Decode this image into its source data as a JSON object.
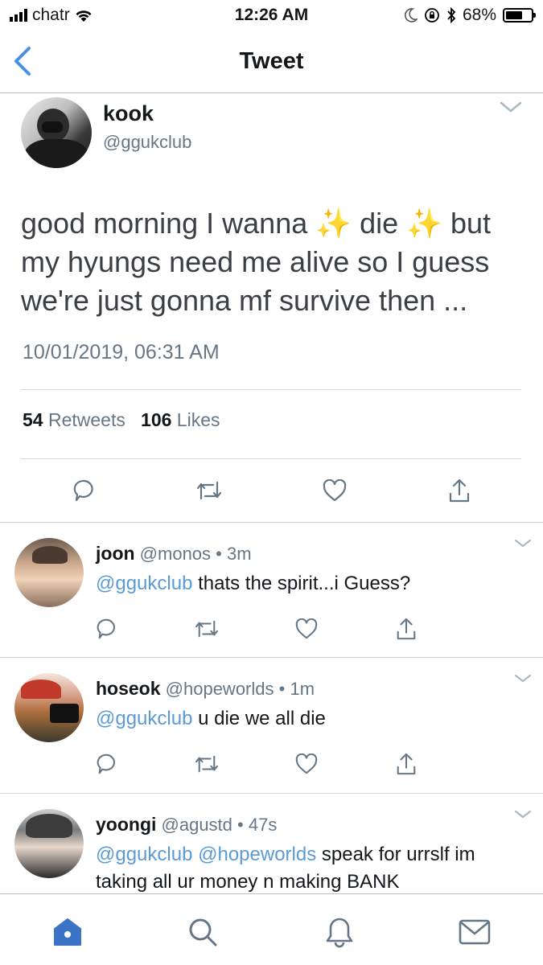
{
  "status_bar": {
    "carrier": "chatr",
    "time": "12:26 AM",
    "battery": "68%",
    "battery_level": 0.68
  },
  "nav": {
    "title": "Tweet"
  },
  "main_tweet": {
    "name": "kook",
    "handle": "@ggukclub",
    "text_part1": "good morning I wanna ",
    "sparkle": "✨",
    "text_part2": " die ",
    "text_part3": " but my hyungs need me alive so I guess we're just gonna mf survive then ...",
    "timestamp": "10/01/2019, 06:31 AM",
    "retweets_count": "54",
    "retweets_label": "Retweets",
    "likes_count": "106",
    "likes_label": "Likes"
  },
  "replies": [
    {
      "name": "joon",
      "handle": "@monos",
      "time": "3m",
      "mentions": "@ggukclub",
      "text": " thats the spirit...i Guess?"
    },
    {
      "name": "hoseok",
      "handle": "@hopeworlds",
      "time": "1m",
      "mentions": "@ggukclub",
      "text": " u die we all die"
    },
    {
      "name": "yoongi",
      "handle": "@agustd",
      "time": "47s",
      "mentions": "@ggukclub @hopeworlds",
      "text": " speak for urrslf im taking all ur money n making BANK"
    }
  ],
  "separator": "•",
  "colors": {
    "accent": "#4a90e2",
    "tab_active": "#3b73c7",
    "mention": "#5b9bd5",
    "muted": "#657786"
  },
  "icons": {
    "tabs": [
      "home-icon",
      "search-icon",
      "notifications-bell-icon",
      "messages-envelope-icon"
    ],
    "actions": [
      "reply-icon",
      "retweet-icon",
      "like-heart-icon",
      "share-icon"
    ]
  }
}
